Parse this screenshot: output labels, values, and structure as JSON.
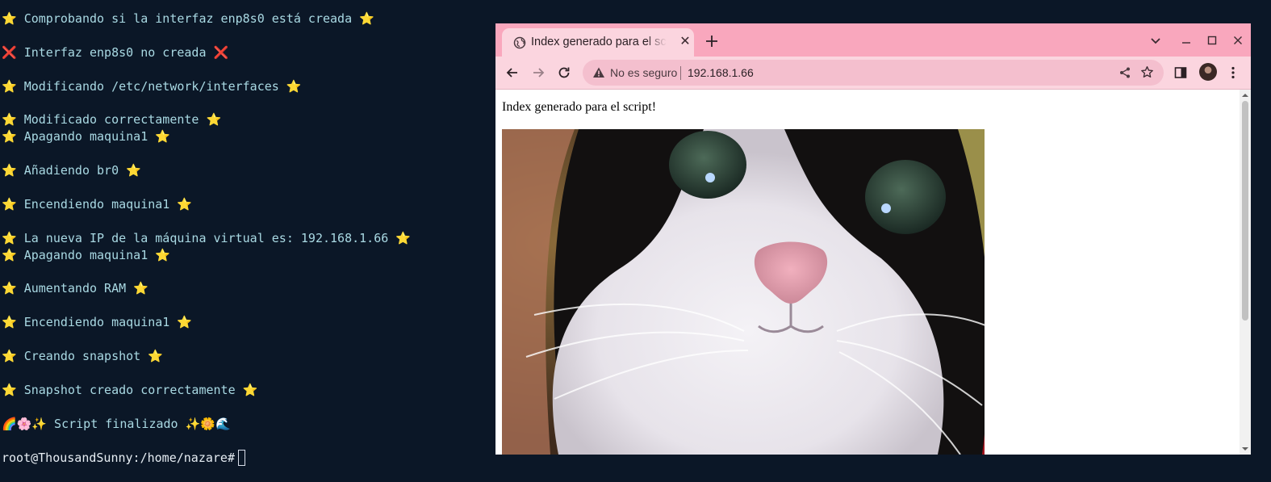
{
  "terminal": {
    "lines": [
      {
        "pre": "⭐",
        "text": " Comprobando si la interfaz enp8s0 está creada ",
        "post": "⭐"
      },
      {
        "pre": "❌",
        "text": " Interfaz enp8s0 no creada ",
        "post": "❌"
      },
      {
        "pre": "⭐",
        "text": " Modificando /etc/network/interfaces ",
        "post": "⭐"
      },
      {
        "pre": "⭐",
        "text": " Modificado correctamente ",
        "post": "⭐"
      },
      {
        "pre": "⭐",
        "text": " Apagando maquina1 ",
        "post": "⭐"
      },
      {
        "pre": "⭐",
        "text": " Añadiendo br0 ",
        "post": "⭐"
      },
      {
        "pre": "⭐",
        "text": " Encendiendo maquina1 ",
        "post": "⭐"
      },
      {
        "pre": "⭐",
        "text": " La nueva IP de la máquina virtual es: 192.168.1.66 ",
        "post": "⭐"
      },
      {
        "pre": "⭐",
        "text": " Apagando maquina1 ",
        "post": "⭐"
      },
      {
        "pre": "⭐",
        "text": " Aumentando RAM ",
        "post": "⭐"
      },
      {
        "pre": "⭐",
        "text": " Encendiendo maquina1 ",
        "post": "⭐"
      },
      {
        "pre": "⭐",
        "text": " Creando snapshot ",
        "post": "⭐"
      },
      {
        "pre": "⭐",
        "text": " Snapshot creado correctamente ",
        "post": "⭐"
      },
      {
        "pre": "🌈🌸✨",
        "text": " Script finalizado ",
        "post": "✨🌼🌊"
      }
    ],
    "prompt": "root@ThousandSunny:/home/nazare#"
  },
  "browser": {
    "tab_title": "Index generado para el script!",
    "address": {
      "security_label": "No es seguro",
      "url": "192.168.1.66"
    },
    "page": {
      "text": "Index generado para el script!",
      "image": "cat-photo"
    },
    "colors": {
      "tabstrip": "#f9a7bd",
      "toolbar": "#fbd5df",
      "omnibox": "#f4bfce"
    }
  }
}
